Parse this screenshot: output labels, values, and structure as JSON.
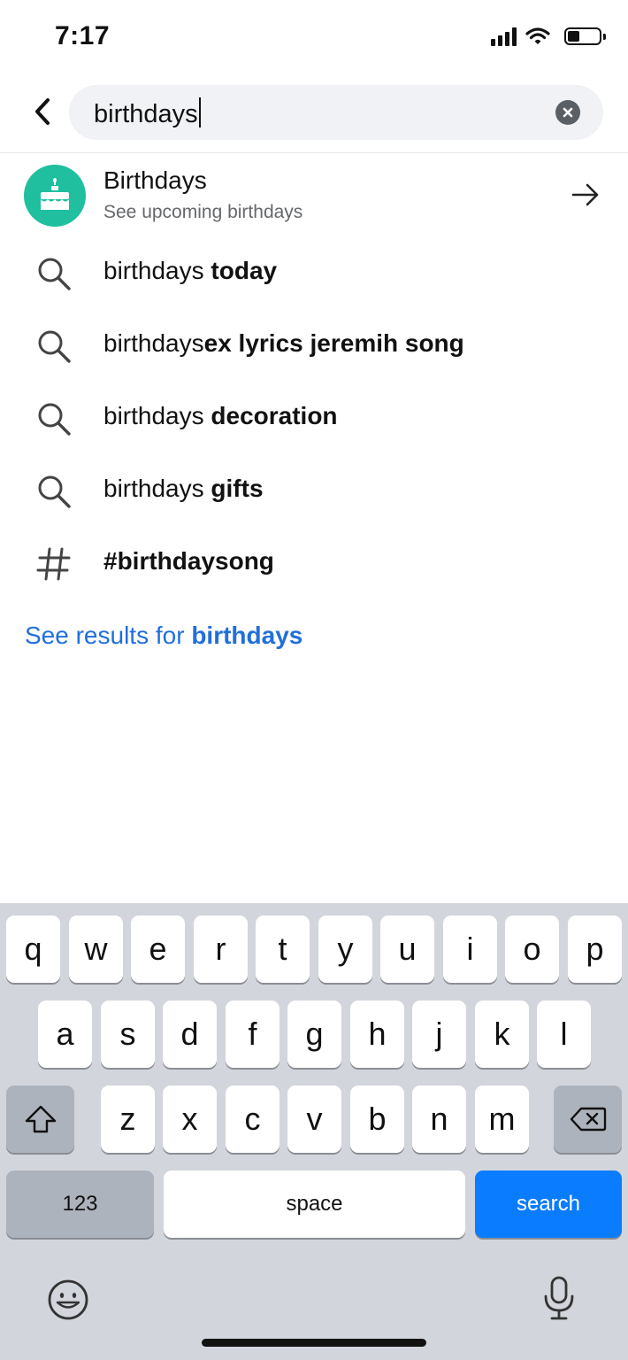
{
  "status": {
    "time": "7:17"
  },
  "search": {
    "query": "birthdays"
  },
  "top_result": {
    "title": "Birthdays",
    "subtitle": "See upcoming birthdays"
  },
  "suggestions": [
    {
      "prefix": "birthdays ",
      "bold": "today",
      "icon": "search-icon"
    },
    {
      "prefix": "birthdays",
      "bold": "ex lyrics jeremih song",
      "icon": "search-icon"
    },
    {
      "prefix": "birthdays ",
      "bold": "decoration",
      "icon": "search-icon"
    },
    {
      "prefix": "birthdays ",
      "bold": "gifts",
      "icon": "search-icon"
    },
    {
      "prefix": "",
      "bold": "#birthdaysong",
      "icon": "hashtag-icon"
    }
  ],
  "see_results": {
    "prefix": "See results for ",
    "bold": "birthdays"
  },
  "keyboard": {
    "row1": [
      "q",
      "w",
      "e",
      "r",
      "t",
      "y",
      "u",
      "i",
      "o",
      "p"
    ],
    "row2": [
      "a",
      "s",
      "d",
      "f",
      "g",
      "h",
      "j",
      "k",
      "l"
    ],
    "row3": [
      "z",
      "x",
      "c",
      "v",
      "b",
      "n",
      "m"
    ],
    "numbers_label": "123",
    "space_label": "space",
    "search_label": "search"
  },
  "colors": {
    "accent": "#216fdb",
    "avatar": "#1fbf9f",
    "search_key": "#0a7cff"
  }
}
